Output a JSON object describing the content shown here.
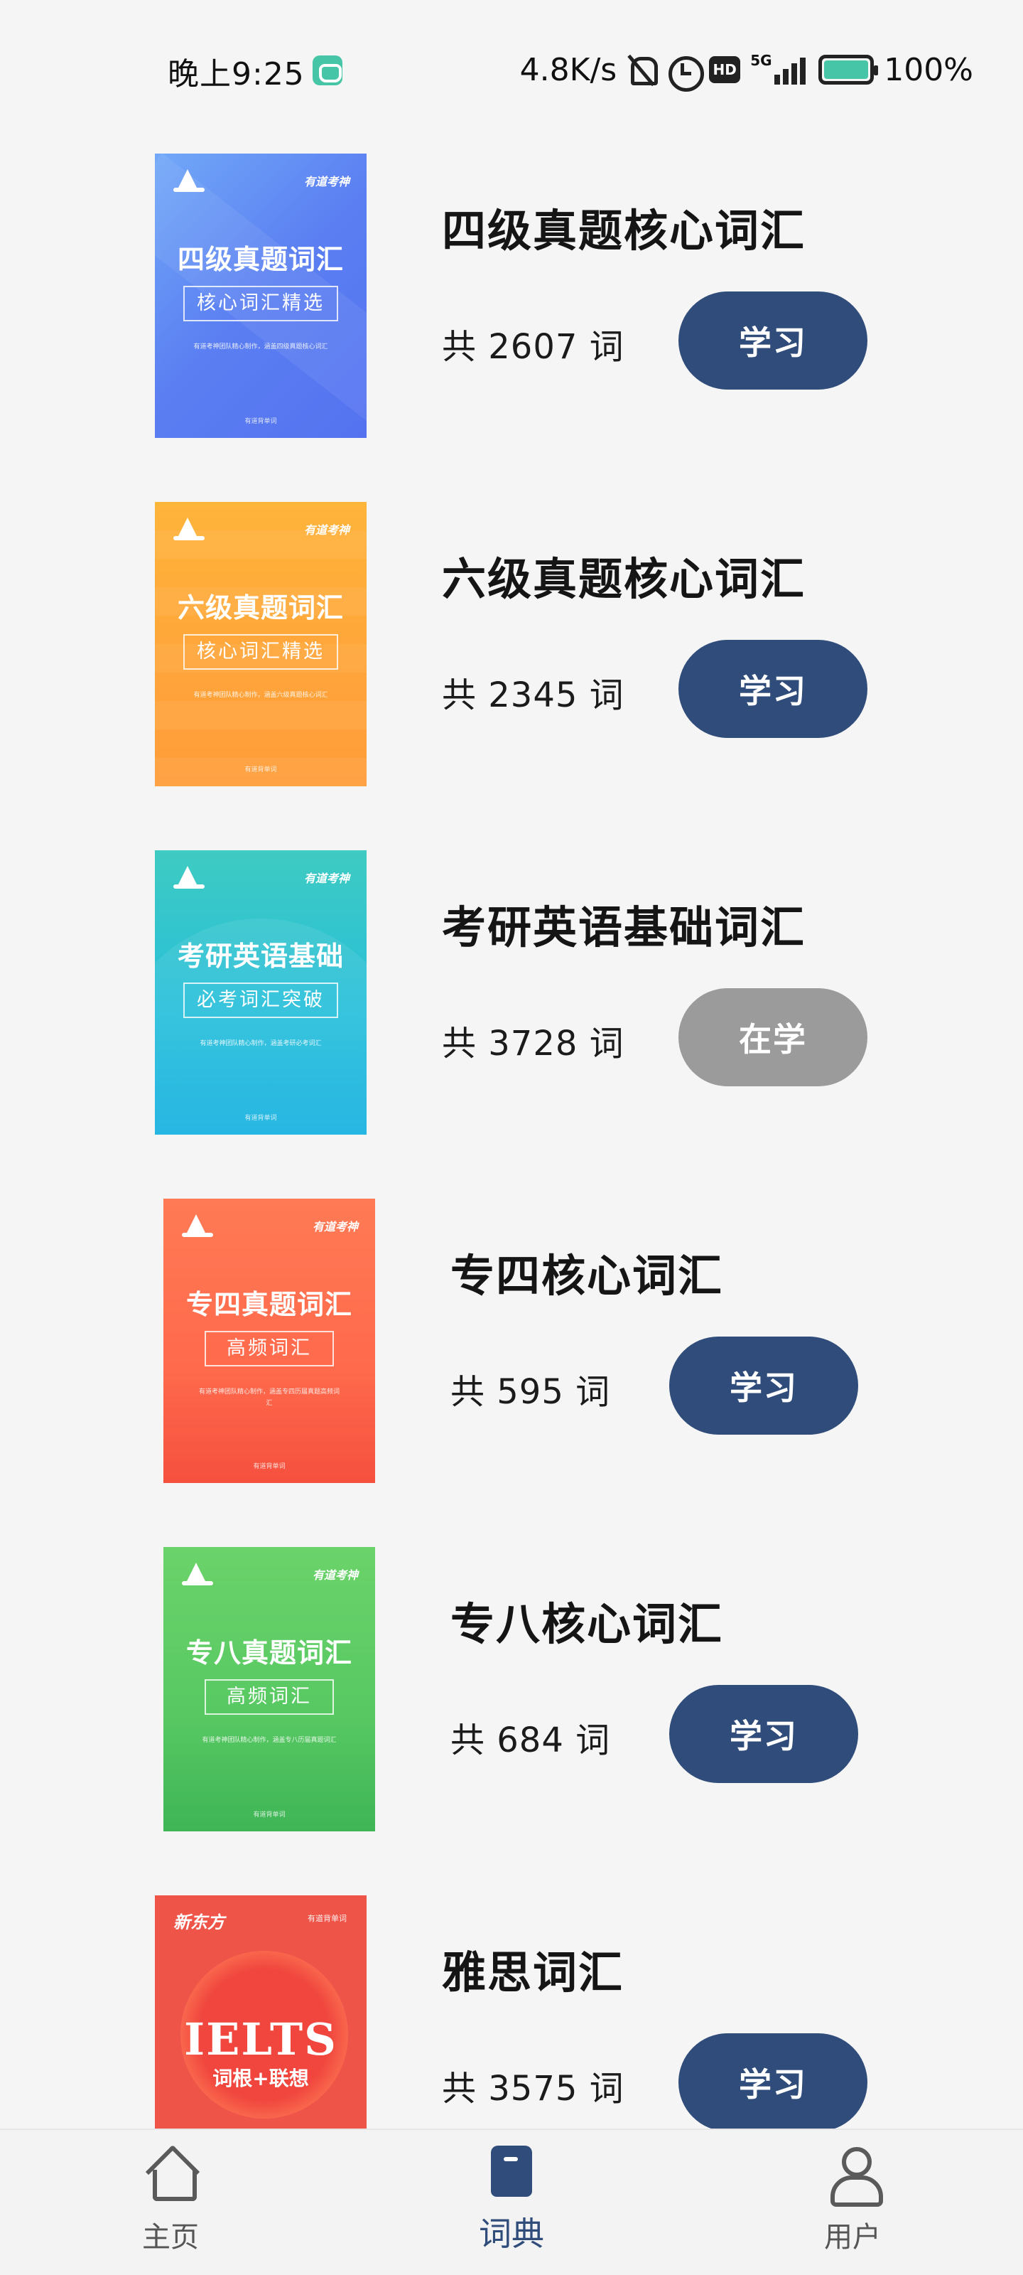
{
  "status_bar": {
    "time": "晚上9:25",
    "network_speed": "4.8K/s",
    "hd_label": "HD",
    "signal_label": "5G",
    "battery_percent": "100%",
    "battery_level": 1.0,
    "battery_color": "#47c6a7"
  },
  "books": [
    {
      "title": "四级真题核心词汇",
      "count": "共 2607 词",
      "button": "学习",
      "cover": {
        "brand": "有道考神",
        "title": "四级真题词汇",
        "subtitle": "核心词汇精选",
        "desc": "有道考神团队精心制作，涵盖四级真题核心词汇",
        "footer": "有道背单词"
      }
    },
    {
      "title": "六级真题核心词汇",
      "count": "共 2345 词",
      "button": "学习",
      "cover": {
        "brand": "有道考神",
        "title": "六级真题词汇",
        "subtitle": "核心词汇精选",
        "desc": "有道考神团队精心制作，涵盖六级真题核心词汇",
        "footer": "有道背单词"
      }
    },
    {
      "title": "考研英语基础词汇",
      "count": "共 3728 词",
      "button": "在学",
      "cover": {
        "brand": "有道考神",
        "title": "考研英语基础",
        "subtitle": "必考词汇突破",
        "desc": "有道考神团队精心制作，涵盖考研必考词汇",
        "footer": "有道背单词"
      }
    },
    {
      "title": "专四核心词汇",
      "count": "共 595 词",
      "button": "学习",
      "cover": {
        "brand": "有道考神",
        "title": "专四真题词汇",
        "subtitle": "高频词汇",
        "desc": "有道考神团队精心制作，涵盖专四历届真题高频词汇",
        "footer": "有道背单词"
      }
    },
    {
      "title": "专八核心词汇",
      "count": "共 684 词",
      "button": "学习",
      "cover": {
        "brand": "有道考神",
        "title": "专八真题词汇",
        "subtitle": "高频词汇",
        "desc": "有道考神团队精心制作，涵盖专八历届真题词汇",
        "footer": "有道背单词"
      }
    },
    {
      "title": "雅思词汇",
      "count": "共 3575 词",
      "button": "学习",
      "cover": {
        "brand": "新东方",
        "tag": "有道背单词",
        "title": "IELTS",
        "subtitle": "词根+联想"
      }
    }
  ],
  "bottom_nav": {
    "items": [
      {
        "label": "主页",
        "icon": "home-icon"
      },
      {
        "label": "词典",
        "icon": "dictionary-icon",
        "active": true
      },
      {
        "label": "用户",
        "icon": "user-icon"
      }
    ]
  },
  "colors": {
    "primary": "#2f4c7a",
    "active_button": "#9b9b9b",
    "background": "#f5f5f5"
  }
}
